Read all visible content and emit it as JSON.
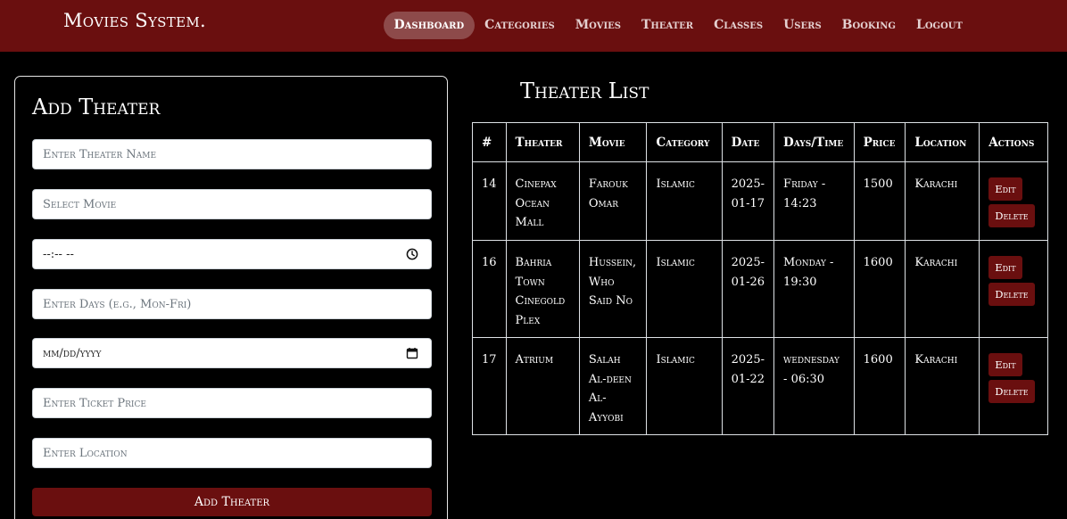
{
  "navbar": {
    "brand": "Movies System.",
    "links": [
      {
        "label": "Dashboard",
        "active": true
      },
      {
        "label": "Categories"
      },
      {
        "label": "Movies"
      },
      {
        "label": "Theater"
      },
      {
        "label": "Classes"
      },
      {
        "label": "Users"
      },
      {
        "label": "Booking"
      },
      {
        "label": "Logout"
      }
    ]
  },
  "form": {
    "title": "Add Theater",
    "theater_name_placeholder": "Enter Theater Name",
    "movie_placeholder": "Select Movie",
    "time_value": "--:-- --",
    "days_placeholder": "Enter Days (e.g., Mon-Fri)",
    "date_value": "mm/dd/yyyy",
    "price_placeholder": "Enter Ticket Price",
    "location_placeholder": "Enter Location",
    "submit_label": "Add Theater"
  },
  "list": {
    "title": "Theater List",
    "headers": [
      "#",
      "Theater",
      "Movie",
      "Category",
      "Date",
      "Days/Time",
      "Price",
      "Location",
      "Actions"
    ],
    "edit_label": "Edit",
    "delete_label": "Delete",
    "rows": [
      {
        "id": "14",
        "theater": "Cinepax Ocean Mall",
        "movie": "Farouk Omar",
        "category": "Islamic",
        "date": "2025-01-17",
        "days_time": "Friday - 14:23",
        "price": "1500",
        "location": "Karachi"
      },
      {
        "id": "16",
        "theater": "Bahria Town Cinegold Plex",
        "movie": "Hussein, Who Said No",
        "category": "Islamic",
        "date": "2025-01-26",
        "days_time": "Monday - 19:30",
        "price": "1600",
        "location": "Karachi"
      },
      {
        "id": "17",
        "theater": "Atrium",
        "movie": "Salah Al-deen Al-Ayyobi",
        "category": "Islamic",
        "date": "2025-01-22",
        "days_time": "wednesday - 06:30",
        "price": "1600",
        "location": "Karachi"
      }
    ]
  },
  "colors": {
    "navbar_bg": "#6a0f0f",
    "accent": "#6a0f0f",
    "active_pill": "#8d4a4a",
    "page_bg": "#000000"
  }
}
